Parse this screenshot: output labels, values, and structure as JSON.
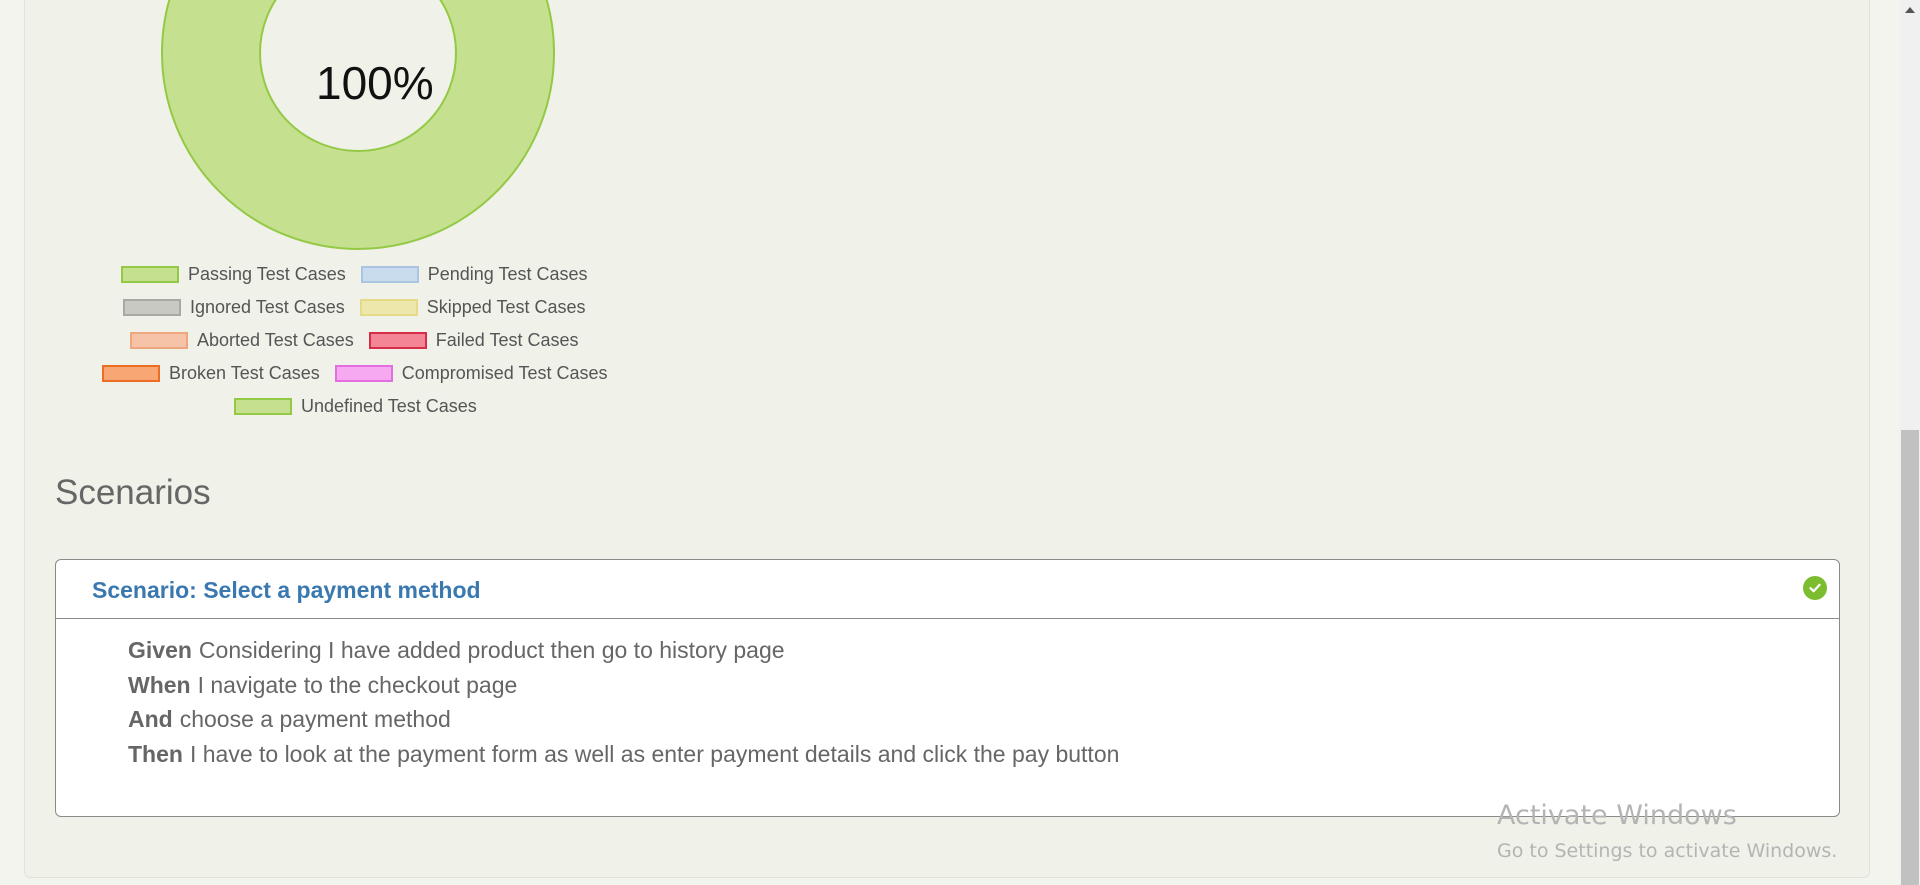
{
  "chart": {
    "percentage_label": "100%",
    "colors": {
      "passing_fill": "#c5e08e",
      "passing_stroke": "#94c946",
      "hole": "#f0f1e9"
    }
  },
  "legend": [
    [
      {
        "label": "Passing Test Cases",
        "fill": "#c5e08e",
        "stroke": "#94c946"
      },
      {
        "label": "Pending Test Cases",
        "fill": "#c9dcee",
        "stroke": "#a9c5e2"
      }
    ],
    [
      {
        "label": "Ignored Test Cases",
        "fill": "#c9c9c3",
        "stroke": "#a9a9a3"
      },
      {
        "label": "Skipped Test Cases",
        "fill": "#eee7ac",
        "stroke": "#e5da88"
      }
    ],
    [
      {
        "label": "Aborted Test Cases",
        "fill": "#f6c3a8",
        "stroke": "#eea67f"
      },
      {
        "label": "Failed Test Cases",
        "fill": "#f48595",
        "stroke": "#d62e48"
      }
    ],
    [
      {
        "label": "Broken Test Cases",
        "fill": "#f8a774",
        "stroke": "#ec6e22"
      },
      {
        "label": "Compromised Test Cases",
        "fill": "#f6a9f0",
        "stroke": "#e36ee0"
      }
    ],
    [
      {
        "label": "Undefined Test Cases",
        "fill": "#c5e08e",
        "stroke": "#94c946"
      }
    ]
  ],
  "scenarios_section": {
    "title": "Scenarios",
    "scenario": {
      "title": "Scenario: Select a payment method",
      "status_icon": "check-circle-icon",
      "status_color": "#7cbc2f",
      "steps": [
        {
          "keyword": "Given",
          "text": "Considering I have added product then go to history page"
        },
        {
          "keyword": "When",
          "text": "I navigate to the checkout page"
        },
        {
          "keyword": "And",
          "text": "choose a payment method"
        },
        {
          "keyword": "Then",
          "text": "I have to look at the payment form as well as enter payment details and click the pay button"
        }
      ]
    }
  },
  "watermark": {
    "line1": "Activate Windows",
    "line2": "Go to Settings to activate Windows."
  }
}
